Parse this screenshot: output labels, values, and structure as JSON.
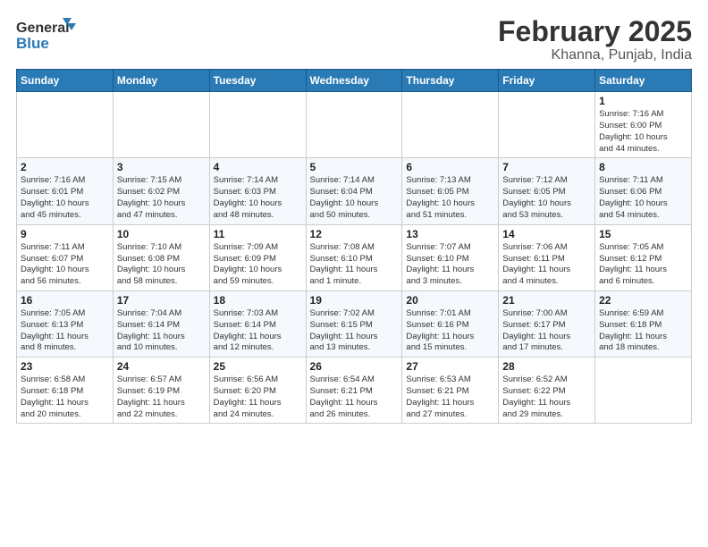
{
  "header": {
    "logo_line1": "General",
    "logo_line2": "Blue",
    "month": "February 2025",
    "location": "Khanna, Punjab, India"
  },
  "weekdays": [
    "Sunday",
    "Monday",
    "Tuesday",
    "Wednesday",
    "Thursday",
    "Friday",
    "Saturday"
  ],
  "weeks": [
    [
      {
        "day": "",
        "info": ""
      },
      {
        "day": "",
        "info": ""
      },
      {
        "day": "",
        "info": ""
      },
      {
        "day": "",
        "info": ""
      },
      {
        "day": "",
        "info": ""
      },
      {
        "day": "",
        "info": ""
      },
      {
        "day": "1",
        "info": "Sunrise: 7:16 AM\nSunset: 6:00 PM\nDaylight: 10 hours\nand 44 minutes."
      }
    ],
    [
      {
        "day": "2",
        "info": "Sunrise: 7:16 AM\nSunset: 6:01 PM\nDaylight: 10 hours\nand 45 minutes."
      },
      {
        "day": "3",
        "info": "Sunrise: 7:15 AM\nSunset: 6:02 PM\nDaylight: 10 hours\nand 47 minutes."
      },
      {
        "day": "4",
        "info": "Sunrise: 7:14 AM\nSunset: 6:03 PM\nDaylight: 10 hours\nand 48 minutes."
      },
      {
        "day": "5",
        "info": "Sunrise: 7:14 AM\nSunset: 6:04 PM\nDaylight: 10 hours\nand 50 minutes."
      },
      {
        "day": "6",
        "info": "Sunrise: 7:13 AM\nSunset: 6:05 PM\nDaylight: 10 hours\nand 51 minutes."
      },
      {
        "day": "7",
        "info": "Sunrise: 7:12 AM\nSunset: 6:05 PM\nDaylight: 10 hours\nand 53 minutes."
      },
      {
        "day": "8",
        "info": "Sunrise: 7:11 AM\nSunset: 6:06 PM\nDaylight: 10 hours\nand 54 minutes."
      }
    ],
    [
      {
        "day": "9",
        "info": "Sunrise: 7:11 AM\nSunset: 6:07 PM\nDaylight: 10 hours\nand 56 minutes."
      },
      {
        "day": "10",
        "info": "Sunrise: 7:10 AM\nSunset: 6:08 PM\nDaylight: 10 hours\nand 58 minutes."
      },
      {
        "day": "11",
        "info": "Sunrise: 7:09 AM\nSunset: 6:09 PM\nDaylight: 10 hours\nand 59 minutes."
      },
      {
        "day": "12",
        "info": "Sunrise: 7:08 AM\nSunset: 6:10 PM\nDaylight: 11 hours\nand 1 minute."
      },
      {
        "day": "13",
        "info": "Sunrise: 7:07 AM\nSunset: 6:10 PM\nDaylight: 11 hours\nand 3 minutes."
      },
      {
        "day": "14",
        "info": "Sunrise: 7:06 AM\nSunset: 6:11 PM\nDaylight: 11 hours\nand 4 minutes."
      },
      {
        "day": "15",
        "info": "Sunrise: 7:05 AM\nSunset: 6:12 PM\nDaylight: 11 hours\nand 6 minutes."
      }
    ],
    [
      {
        "day": "16",
        "info": "Sunrise: 7:05 AM\nSunset: 6:13 PM\nDaylight: 11 hours\nand 8 minutes."
      },
      {
        "day": "17",
        "info": "Sunrise: 7:04 AM\nSunset: 6:14 PM\nDaylight: 11 hours\nand 10 minutes."
      },
      {
        "day": "18",
        "info": "Sunrise: 7:03 AM\nSunset: 6:14 PM\nDaylight: 11 hours\nand 12 minutes."
      },
      {
        "day": "19",
        "info": "Sunrise: 7:02 AM\nSunset: 6:15 PM\nDaylight: 11 hours\nand 13 minutes."
      },
      {
        "day": "20",
        "info": "Sunrise: 7:01 AM\nSunset: 6:16 PM\nDaylight: 11 hours\nand 15 minutes."
      },
      {
        "day": "21",
        "info": "Sunrise: 7:00 AM\nSunset: 6:17 PM\nDaylight: 11 hours\nand 17 minutes."
      },
      {
        "day": "22",
        "info": "Sunrise: 6:59 AM\nSunset: 6:18 PM\nDaylight: 11 hours\nand 18 minutes."
      }
    ],
    [
      {
        "day": "23",
        "info": "Sunrise: 6:58 AM\nSunset: 6:18 PM\nDaylight: 11 hours\nand 20 minutes."
      },
      {
        "day": "24",
        "info": "Sunrise: 6:57 AM\nSunset: 6:19 PM\nDaylight: 11 hours\nand 22 minutes."
      },
      {
        "day": "25",
        "info": "Sunrise: 6:56 AM\nSunset: 6:20 PM\nDaylight: 11 hours\nand 24 minutes."
      },
      {
        "day": "26",
        "info": "Sunrise: 6:54 AM\nSunset: 6:21 PM\nDaylight: 11 hours\nand 26 minutes."
      },
      {
        "day": "27",
        "info": "Sunrise: 6:53 AM\nSunset: 6:21 PM\nDaylight: 11 hours\nand 27 minutes."
      },
      {
        "day": "28",
        "info": "Sunrise: 6:52 AM\nSunset: 6:22 PM\nDaylight: 11 hours\nand 29 minutes."
      },
      {
        "day": "",
        "info": ""
      }
    ]
  ]
}
